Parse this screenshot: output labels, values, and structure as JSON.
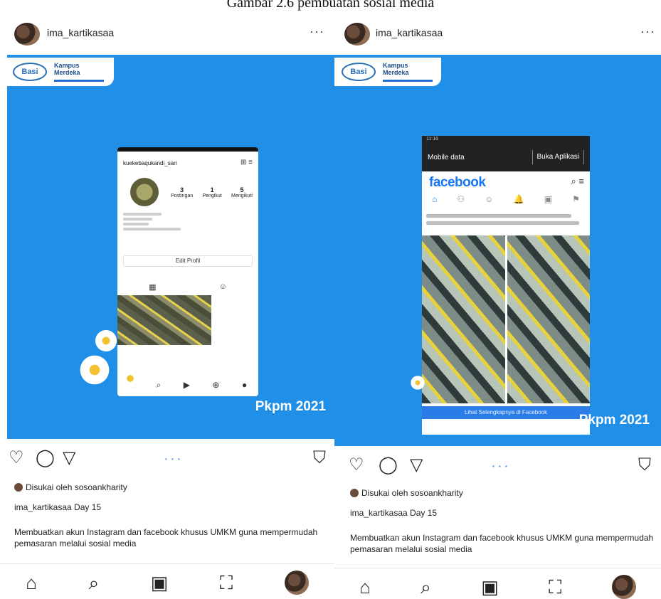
{
  "caption": "Gambar 2.6 pembuatan sosial media",
  "posts": [
    {
      "username": "ima_kartikasaa",
      "more": "···",
      "badge": {
        "oval_text": "Basi",
        "merdeka_line1": "Kampus",
        "merdeka_line2": "Merdeka"
      },
      "phone": {
        "handle": "kuekebaqukandi_sari",
        "top_icons": "⊞  ≡",
        "stats": [
          {
            "num": "3",
            "label": "Postingan"
          },
          {
            "num": "1",
            "label": "Pengikut"
          },
          {
            "num": "5",
            "label": "Mengikuti"
          }
        ],
        "edit_label": "Edit Profil",
        "grid_tabs": [
          "▦",
          "☺"
        ],
        "nav_icons": [
          "⌂",
          "⌕",
          "▶",
          "⊕",
          "●"
        ]
      },
      "footer_tag": "Pkpm 2021",
      "actions": {
        "like": "♡",
        "comment": "◯",
        "share": "▽",
        "save": "⛉",
        "dots": "• • •"
      },
      "liked_by": "Disukai oleh sosoankharity",
      "caption_line": "ima_kartikasaa Day 15",
      "description": "Membuatkan akun Instagram dan facebook khusus UMKM guna mempermudah pemasaran melalui sosial media",
      "bottom_nav": [
        "⌂",
        "⌕",
        "▣",
        "⛶"
      ]
    },
    {
      "username": "ima_kartikasaa",
      "more": "···",
      "badge": {
        "oval_text": "Basi",
        "merdeka_line1": "Kampus",
        "merdeka_line2": "Merdeka"
      },
      "phone": {
        "status": "11:16",
        "mobile_text": "Mobile data",
        "install_text": "Buka Aplikasi",
        "fb_logo": "facebook",
        "fb_actions": "⌕  ≡",
        "fb_tabs": [
          "⌂",
          "⚇",
          "☺",
          "🔔",
          "▣",
          "⚑"
        ],
        "button_label": "Lihat Selengkapnya di Facebook"
      },
      "footer_tag": "Pkpm 2021",
      "actions": {
        "like": "♡",
        "comment": "◯",
        "share": "▽",
        "save": "⛉",
        "dots": "• • •"
      },
      "liked_by": "Disukai oleh sosoankharity",
      "caption_line": "ima_kartikasaa Day 15",
      "description": "Membuatkan akun Instagram dan facebook khusus UMKM guna mempermudah pemasaran melalui sosial media",
      "bottom_nav": [
        "⌂",
        "⌕",
        "▣",
        "⛶"
      ]
    }
  ]
}
